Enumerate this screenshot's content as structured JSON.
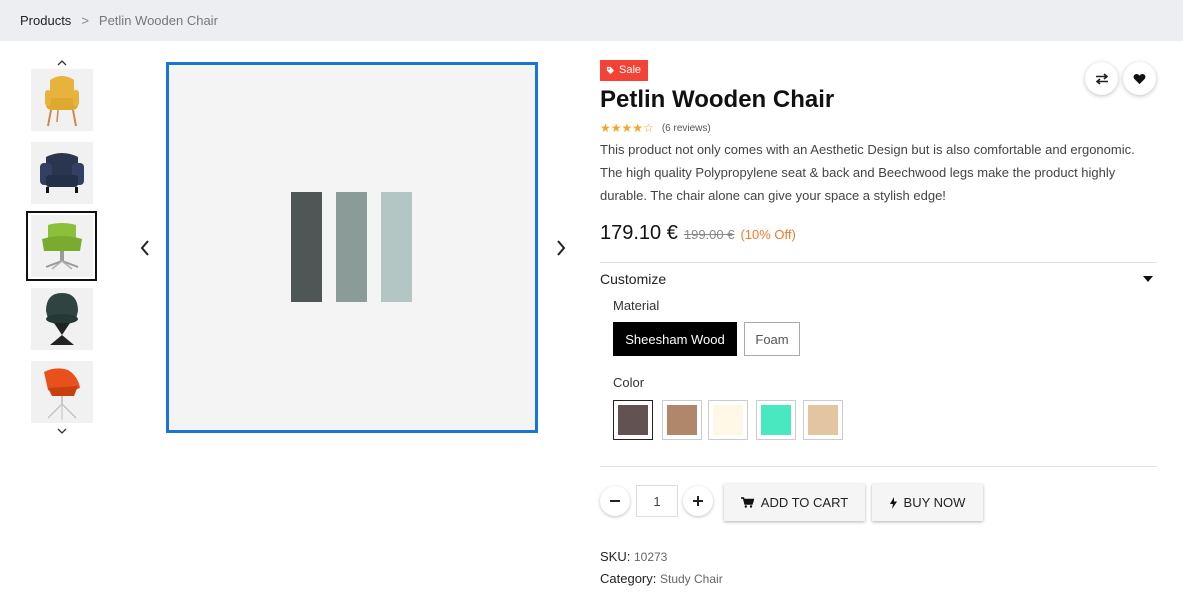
{
  "breadcrumb": {
    "root": "Products",
    "separator": ">",
    "current": "Petlin Wooden Chair"
  },
  "gallery": {
    "thumbnails": [
      {
        "name": "yellow-armchair",
        "color": "#e8b33c",
        "leg": "#c88a4a"
      },
      {
        "name": "navy-wingchair",
        "color": "#2a3550",
        "leg": "#1a1a1a"
      },
      {
        "name": "green-swivel-chair",
        "color": "#8cbf3a",
        "leg": "#9a9a9a"
      },
      {
        "name": "dark-green-chair",
        "color": "#2f4440",
        "leg": "#222"
      },
      {
        "name": "orange-shell-chair",
        "color": "#e8501c",
        "leg": "#bbbbbb"
      }
    ],
    "selected_index": 2,
    "main_bars": [
      "#4f5656",
      "#8a9b98",
      "#b4c6c4"
    ]
  },
  "product": {
    "badge": "Sale",
    "title": "Petlin Wooden Chair",
    "rating": 4,
    "rating_max": 5,
    "reviews": "(6 reviews)",
    "description": "This product not only comes with an Aesthetic Design but is also comfortable and ergonomic. The high quality Polypropylene seat & back and Beechwood legs make the product highly durable. The chair alone can give your space a stylish edge!",
    "price": "179.10 €",
    "old_price": "199.00 €",
    "discount": "(10% Off)"
  },
  "customize": {
    "title": "Customize",
    "material_label": "Material",
    "materials": [
      "Sheesham Wood",
      "Foam"
    ],
    "selected_material": "Sheesham Wood",
    "color_label": "Color",
    "colors": [
      "#625352",
      "#b0876a",
      "#fff8e7",
      "#48e8c0",
      "#e3c6a1"
    ],
    "selected_color_index": 0
  },
  "cart": {
    "quantity": "1",
    "add_to_cart": "ADD TO CART",
    "buy_now": "BUY NOW"
  },
  "meta": {
    "sku_label": "SKU:",
    "sku": "10273",
    "category_label": "Category:",
    "category": "Study Chair"
  },
  "colors": {
    "accent_border": "#1976d2",
    "sale_badge": "#f44336",
    "star": "#f5a623",
    "discount": "#f07a2a"
  },
  "icons": [
    "chevron-up-icon",
    "chevron-down-icon",
    "chevron-left-icon",
    "chevron-right-icon",
    "tag-icon",
    "compare-icon",
    "heart-icon",
    "star-icon",
    "caret-down-icon",
    "minus-icon",
    "plus-icon",
    "cart-icon",
    "bolt-icon"
  ]
}
